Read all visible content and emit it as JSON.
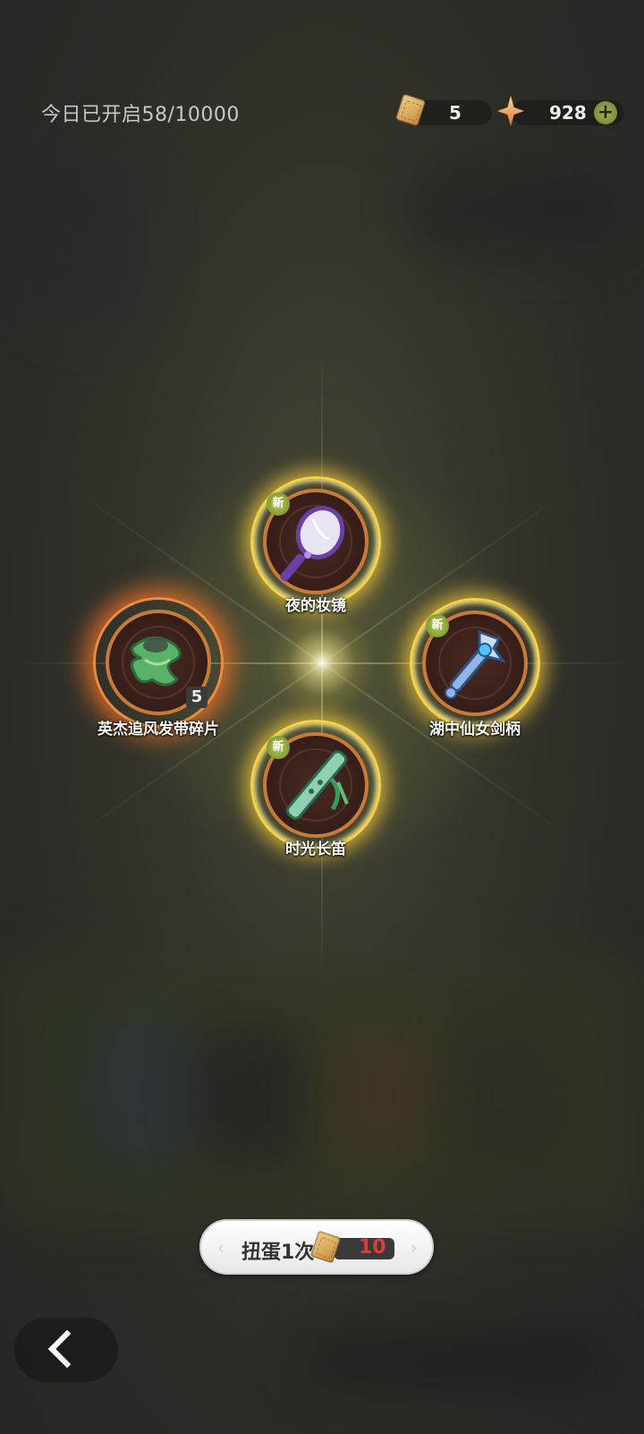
{
  "header": {
    "today_opened": "今日已开启58/10000",
    "ticket_count": "5",
    "star_count": "928",
    "plus_label": "+"
  },
  "items": [
    {
      "name": "夜的妆镜",
      "new_badge": "新",
      "icon": "hand-mirror-icon"
    },
    {
      "name": "英杰追风发带碎片",
      "count": "5",
      "icon": "green-ribbon-icon"
    },
    {
      "name": "湖中仙女剑柄",
      "new_badge": "新",
      "icon": "sword-hilt-icon"
    },
    {
      "name": "时光长笛",
      "new_badge": "新",
      "icon": "jade-flute-icon"
    }
  ],
  "spin": {
    "label": "扭蛋1次",
    "cost": "10"
  },
  "colors": {
    "gold_halo": "#f7d24a",
    "orange_halo": "#f08a3c",
    "new_badge": "#8ea83a",
    "cost_red": "#e53a3a"
  }
}
